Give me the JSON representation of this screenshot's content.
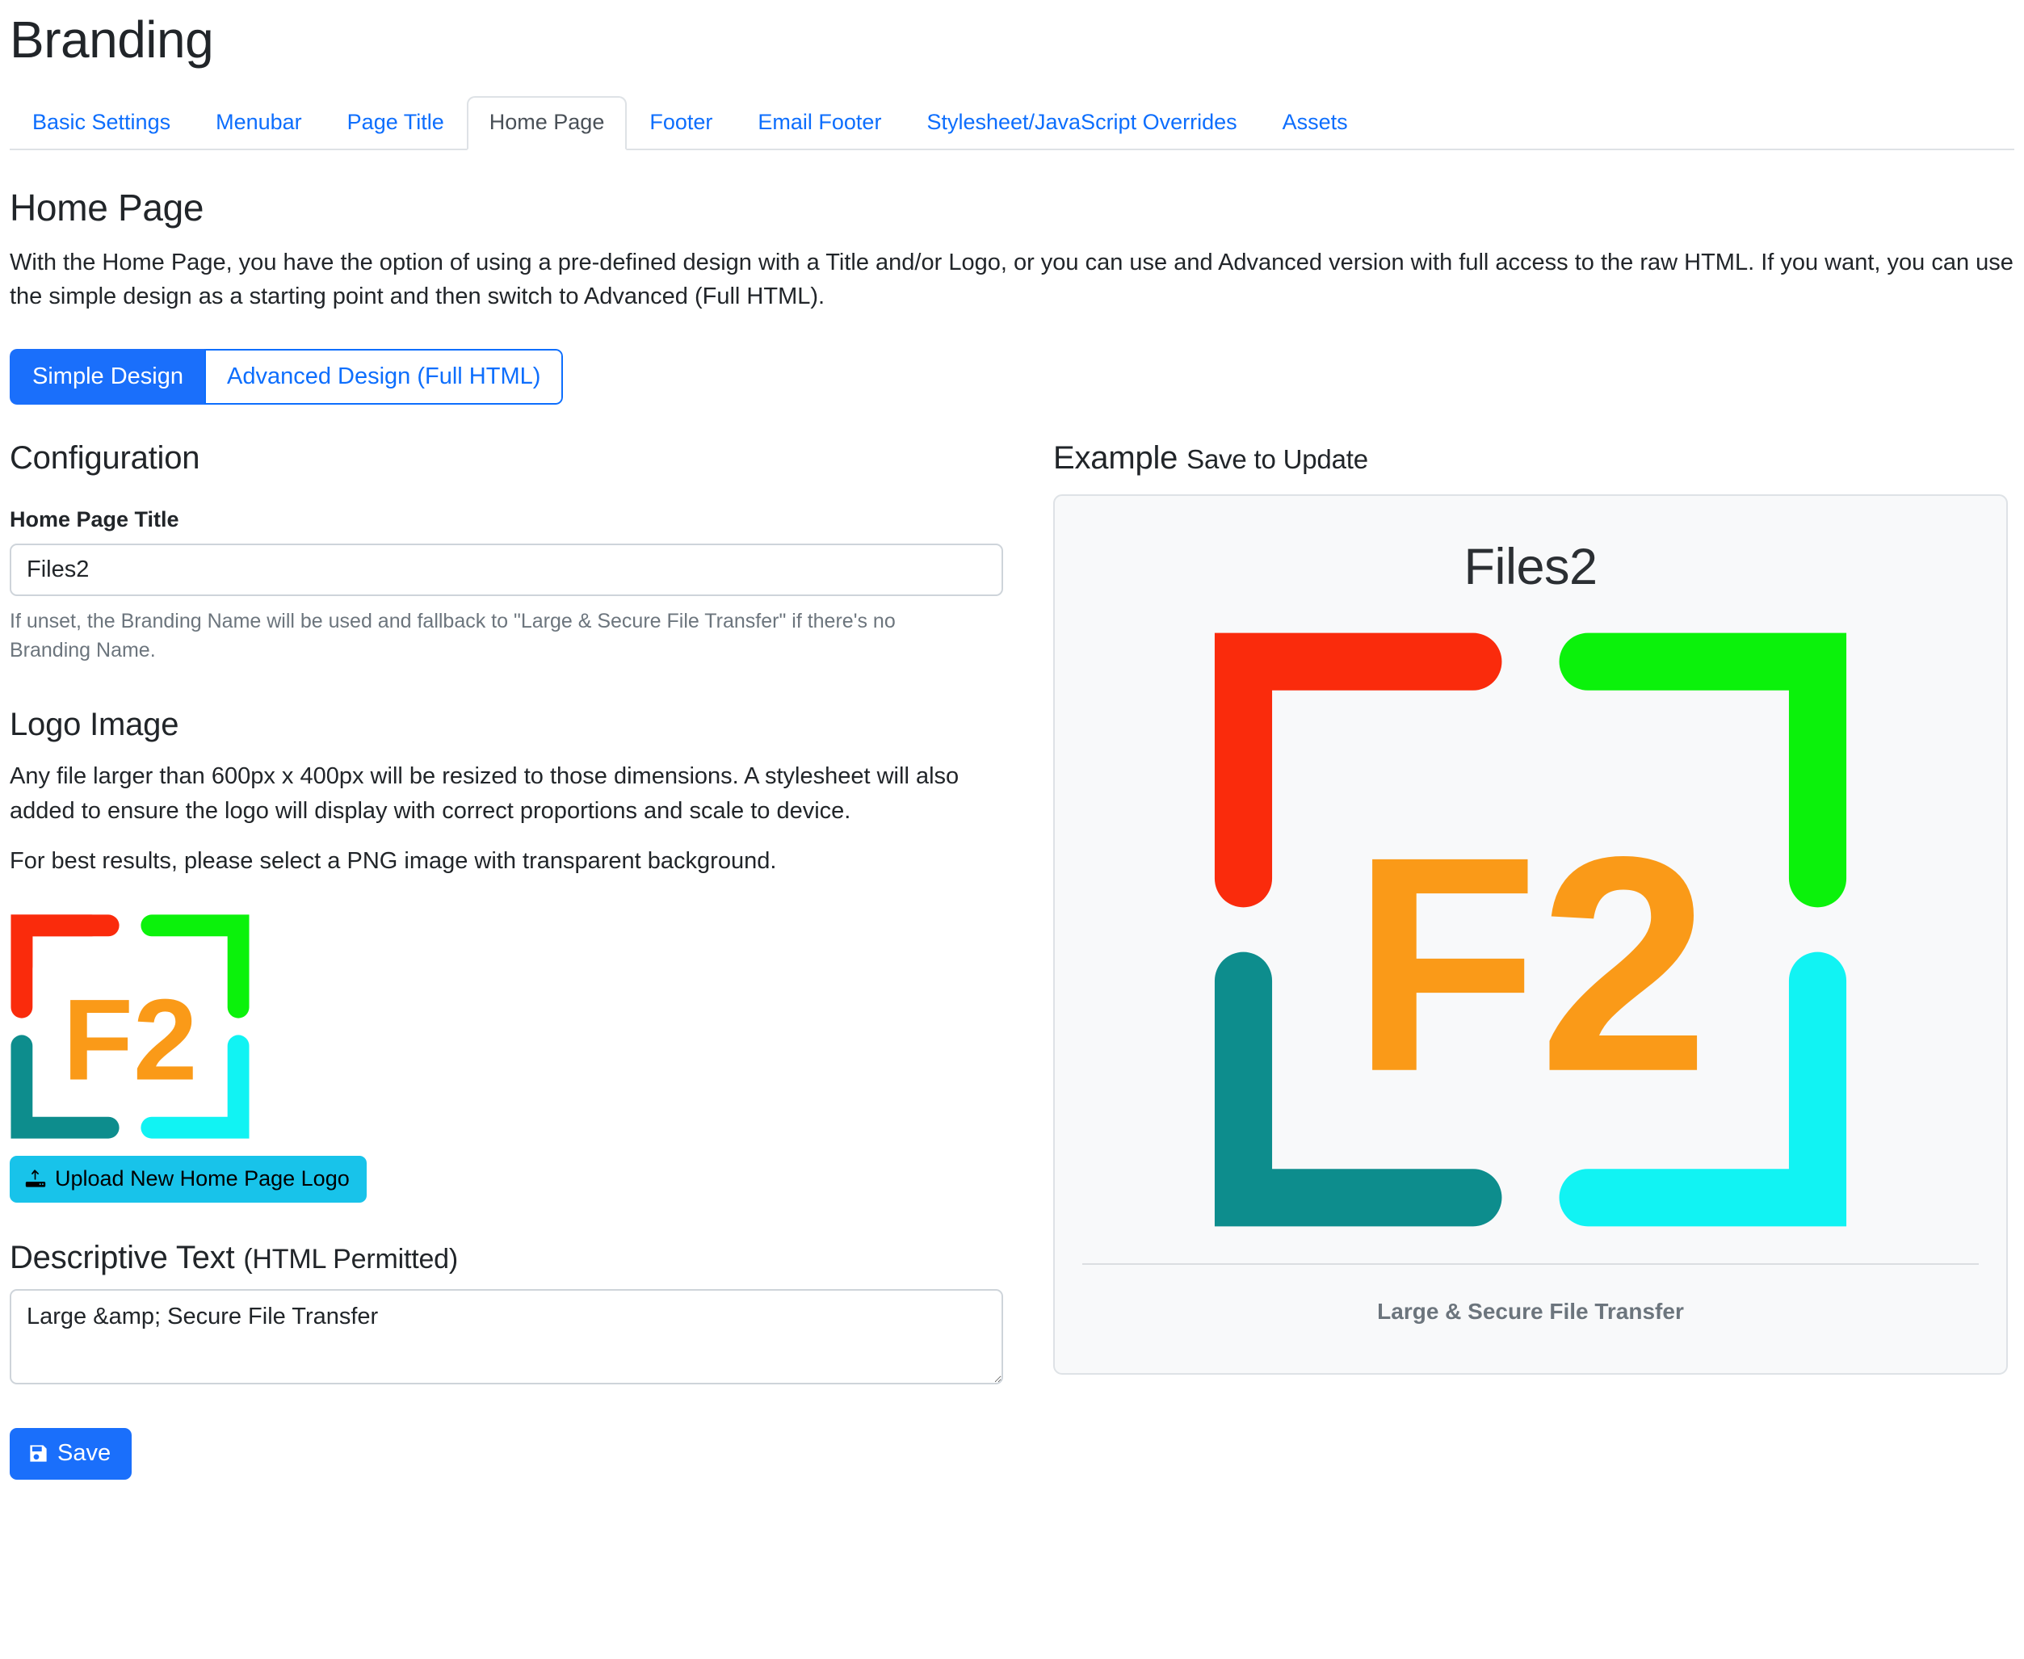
{
  "page": {
    "title": "Branding"
  },
  "tabs": [
    {
      "label": "Basic Settings",
      "active": false
    },
    {
      "label": "Menubar",
      "active": false
    },
    {
      "label": "Page Title",
      "active": false
    },
    {
      "label": "Home Page",
      "active": true
    },
    {
      "label": "Footer",
      "active": false
    },
    {
      "label": "Email Footer",
      "active": false
    },
    {
      "label": "Stylesheet/JavaScript Overrides",
      "active": false
    },
    {
      "label": "Assets",
      "active": false
    }
  ],
  "home_page": {
    "heading": "Home Page",
    "description": "With the Home Page, you have the option of using a pre-defined design with a Title and/or Logo, or you can use and Advanced version with full access to the raw HTML. If you want, you can use the simple design as a starting point and then switch to Advanced (Full HTML)."
  },
  "design_toggle": {
    "simple_label": "Simple Design",
    "advanced_label": "Advanced Design (Full HTML)",
    "selected": "Simple Design"
  },
  "configuration": {
    "heading": "Configuration",
    "title_field": {
      "label": "Home Page Title",
      "value": "Files2",
      "placeholder": "",
      "help": "If unset, the Branding Name will be used and fallback to \"Large & Secure File Transfer\" if there's no Branding Name."
    },
    "logo_image": {
      "heading": "Logo Image",
      "paragraph1": "Any file larger than 600px x 400px will be resized to those dimensions. A stylesheet will also added to ensure the logo will display with correct proportions and scale to device.",
      "paragraph2": "For best results, please select a PNG image with transparent background.",
      "upload_button": "Upload New Home Page Logo"
    },
    "descriptive_text": {
      "heading_main": "Descriptive Text",
      "heading_paren": "(HTML Permitted)",
      "value": "Large &amp; Secure File Transfer",
      "placeholder": ""
    },
    "save_button": "Save"
  },
  "example": {
    "heading_main": "Example",
    "heading_small": "Save to Update",
    "preview_title": "Files2",
    "preview_tagline": "Large & Secure File Transfer"
  },
  "colors": {
    "link": "#0d6efd",
    "primary": "#1a6ffb",
    "upload": "#18c3ea",
    "logo_red": "#fa2b0c",
    "logo_green": "#0bf20b",
    "logo_teal": "#0d8d8d",
    "logo_cyan": "#11f3f3",
    "logo_orange": "#fa9a18",
    "muted": "#6c757d",
    "card_bg": "#f8f9fa",
    "card_border": "#dee2e6"
  },
  "icons": {
    "upload": "upload-icon",
    "save": "floppy-disk-icon"
  }
}
